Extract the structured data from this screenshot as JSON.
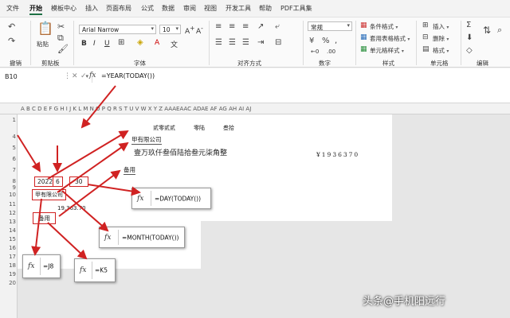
{
  "menu": {
    "tabs": [
      "文件",
      "开始",
      "模板中心",
      "插入",
      "页面布局",
      "公式",
      "数据",
      "审阅",
      "视图",
      "开发工具",
      "帮助",
      "PDF工具集"
    ]
  },
  "ribbon": {
    "paste_label": "粘贴",
    "font_name": "Arial Narrow",
    "font_size": "10",
    "bold": "B",
    "italic": "I",
    "underline": "U",
    "number_format": "常规",
    "conditional_format": "条件格式",
    "table_format": "套用表格格式",
    "cell_style": "单元格样式",
    "insert": "插入",
    "delete": "删除",
    "format": "格式",
    "groups": {
      "undo": "撤销",
      "clipboard": "剪贴板",
      "font": "字体",
      "alignment": "对齐方式",
      "number": "数字",
      "styles": "样式",
      "cells": "单元格",
      "editing": "编辑"
    }
  },
  "formula_bar": {
    "name_box": "B10",
    "fx": "fx",
    "formula": "=YEAR(TODAY())"
  },
  "sheet": {
    "columns_text": "A  B C D E F G H I  J K L  M  N  O  P  Q  R  S  T  U  V W X Y Z AAAEAAC ADAE AF  AG   AH   AI   AJ",
    "columns": [
      "A",
      "B",
      "C",
      "D",
      "E",
      "F",
      "G",
      "H",
      "I",
      "J",
      "K",
      "L",
      "M",
      "N",
      "O",
      "P",
      "Q",
      "R",
      "S",
      "T",
      "U",
      "V",
      "W",
      "X",
      "Y",
      "Z",
      "AA",
      "AE",
      "AC",
      "AD",
      "AE",
      "AF",
      "AG",
      "AH",
      "AI",
      "AJ"
    ],
    "rows": [
      "1",
      "4",
      "5",
      "6",
      "7",
      "8",
      "9",
      "10",
      "11",
      "12",
      "13",
      "14",
      "15",
      "16",
      "17",
      "18",
      "19",
      "20"
    ],
    "header_items": [
      "贰零贰贰",
      "零陆",
      "叁拾"
    ],
    "company_top": "甲有限公司",
    "amount_words": "壹万玖仟叁佰陆拾叁元柒角整",
    "amount_digits": "¥1936370",
    "purpose": "备用",
    "year": "2022",
    "month": "6",
    "day": "30",
    "company_cell": "甲有限公司",
    "amount_num": "19,363.70",
    "purpose_cell": "备用"
  },
  "callouts": {
    "day": "=DAY(TODAY())",
    "month": "=MONTH(TODAY())",
    "j8": "=J8",
    "k5": "=K5"
  },
  "watermark": "头条@手机阳远行",
  "colors": {
    "arrow_red": "#d02222",
    "excel_green": "#1e7145"
  }
}
